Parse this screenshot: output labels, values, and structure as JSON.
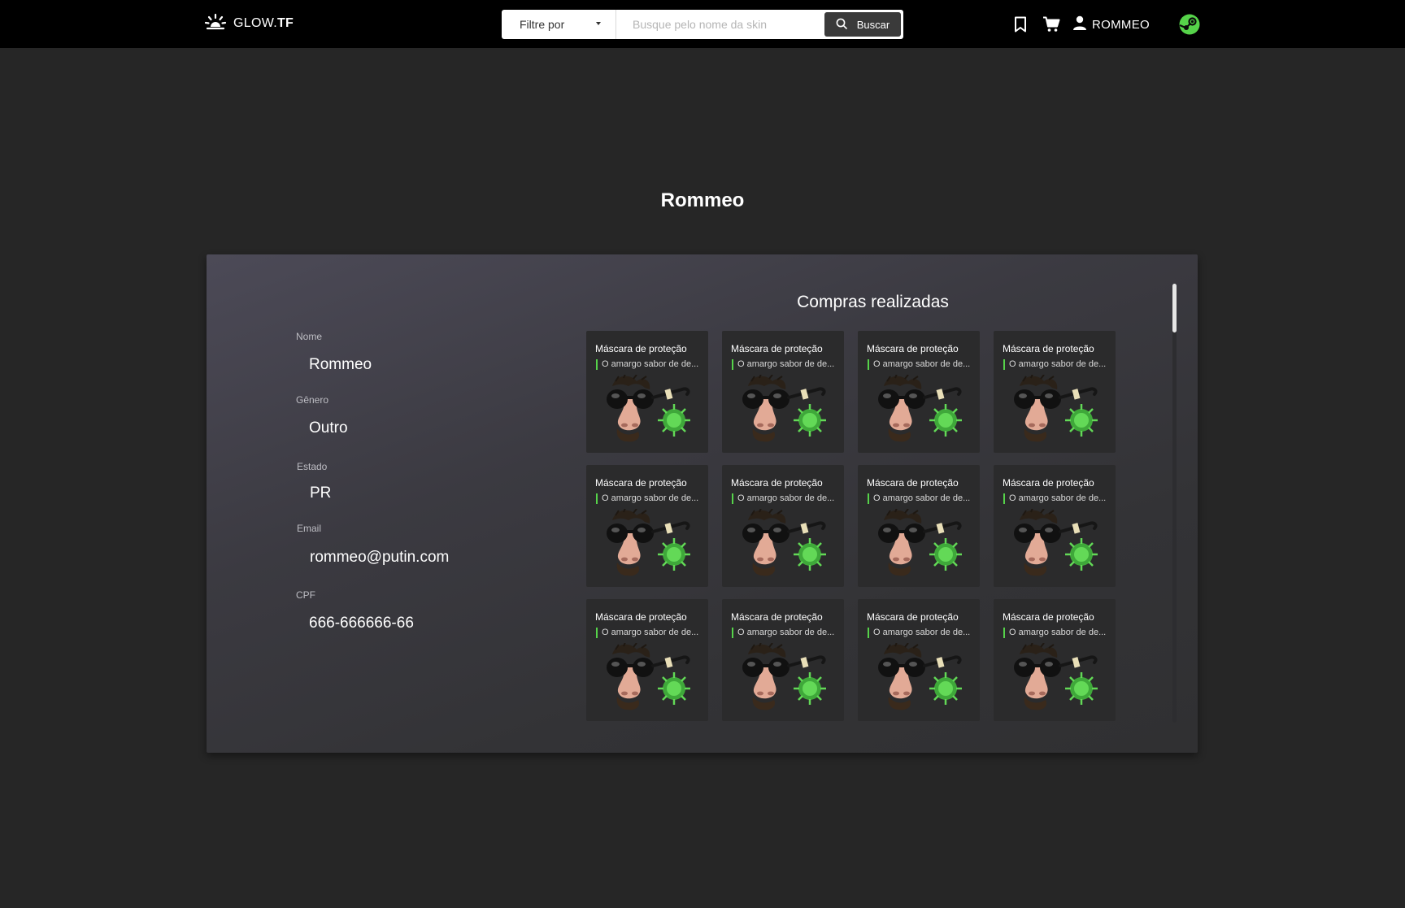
{
  "header": {
    "brand_prefix": "GLOW.",
    "brand_suffix": "TF",
    "filter_label": "Filtre por",
    "search_placeholder": "Busque pelo nome da skin",
    "search_button": "Buscar",
    "username": "ROMMEO",
    "colors": {
      "accent": "#56d34a",
      "bar": "#000000"
    }
  },
  "page": {
    "title": "Rommeo"
  },
  "profile": {
    "fields": [
      {
        "label": "Nome",
        "value": "Rommeo"
      },
      {
        "label": "Gênero",
        "value": "Outro"
      },
      {
        "label": "Estado",
        "value": "PR"
      },
      {
        "label": "Email",
        "value": "rommeo@putin.com"
      },
      {
        "label": "CPF",
        "value": "666-666666-66"
      }
    ]
  },
  "purchases": {
    "title": "Compras realizadas",
    "items": [
      {
        "name": "Máscara de proteção",
        "desc": "O amargo sabor de de..."
      },
      {
        "name": "Máscara de proteção",
        "desc": "O amargo sabor de de..."
      },
      {
        "name": "Máscara de proteção",
        "desc": "O amargo sabor de de..."
      },
      {
        "name": "Máscara de proteção",
        "desc": "O amargo sabor de de..."
      },
      {
        "name": "Máscara de proteção",
        "desc": "O amargo sabor de de..."
      },
      {
        "name": "Máscara de proteção",
        "desc": "O amargo sabor de de..."
      },
      {
        "name": "Máscara de proteção",
        "desc": "O amargo sabor de de..."
      },
      {
        "name": "Máscara de proteção",
        "desc": "O amargo sabor de de..."
      },
      {
        "name": "Máscara de proteção",
        "desc": "O amargo sabor de de..."
      },
      {
        "name": "Máscara de proteção",
        "desc": "O amargo sabor de de..."
      },
      {
        "name": "Máscara de proteção",
        "desc": "O amargo sabor de de..."
      },
      {
        "name": "Máscara de proteção",
        "desc": "O amargo sabor de de..."
      }
    ]
  },
  "icons": {
    "logo": "sunrise-logo-icon",
    "search": "search-icon",
    "bookmark": "bookmark-icon",
    "cart": "cart-icon",
    "user": "user-icon",
    "steam": "steam-icon"
  }
}
